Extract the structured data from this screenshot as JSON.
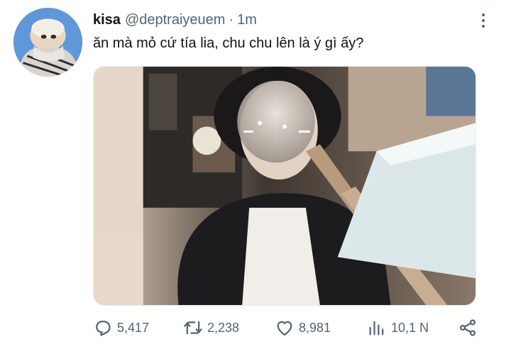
{
  "tweet": {
    "author": {
      "display_name": "kisa",
      "handle": "@deptraiyeuem"
    },
    "separator": "·",
    "time": "1m",
    "text": "ăn mà mỏ cứ tía lia, chu chu lên là ý gì ấy?"
  },
  "actions": {
    "reply": {
      "icon": "reply-icon",
      "count": "5,417"
    },
    "retweet": {
      "icon": "retweet-icon",
      "count": "2,238"
    },
    "like": {
      "icon": "heart-icon",
      "count": "8,981"
    },
    "views": {
      "icon": "views-icon",
      "count": "10,1 N"
    },
    "share": {
      "icon": "share-icon"
    }
  },
  "colors": {
    "primary_text": "#0f1419",
    "secondary_text": "#536471",
    "background": "#ffffff"
  }
}
